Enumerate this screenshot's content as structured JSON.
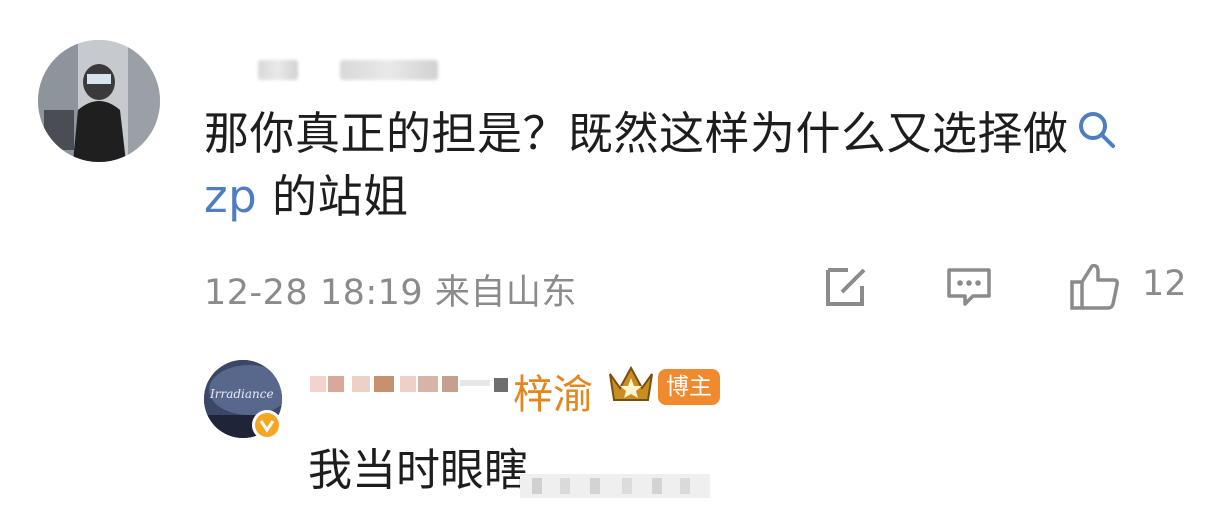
{
  "comment": {
    "text_line1": "那你真正的担是？既然这样为什么又选择做",
    "link_word": "zp",
    "text_line2_rest": " 的站姐",
    "timestamp": "12-28 18:19",
    "location": "来自山东",
    "likes": "12",
    "icons": {
      "search": "search-icon",
      "repost": "share-edit-icon",
      "reply": "comment-icon",
      "like": "thumbs-up-icon"
    }
  },
  "reply": {
    "name_visible": "梓渝",
    "badge": "博主",
    "text": "我当时眼瞎",
    "crown_icon": "crown-icon",
    "verified_icon": "verified-icon",
    "avatar_caption": "Irradiance"
  },
  "colors": {
    "accent_link": "#4f7dc1",
    "name_orange": "#e2861f",
    "badge_bg": "#ef8a2e",
    "meta_gray": "#8b8b8b"
  }
}
